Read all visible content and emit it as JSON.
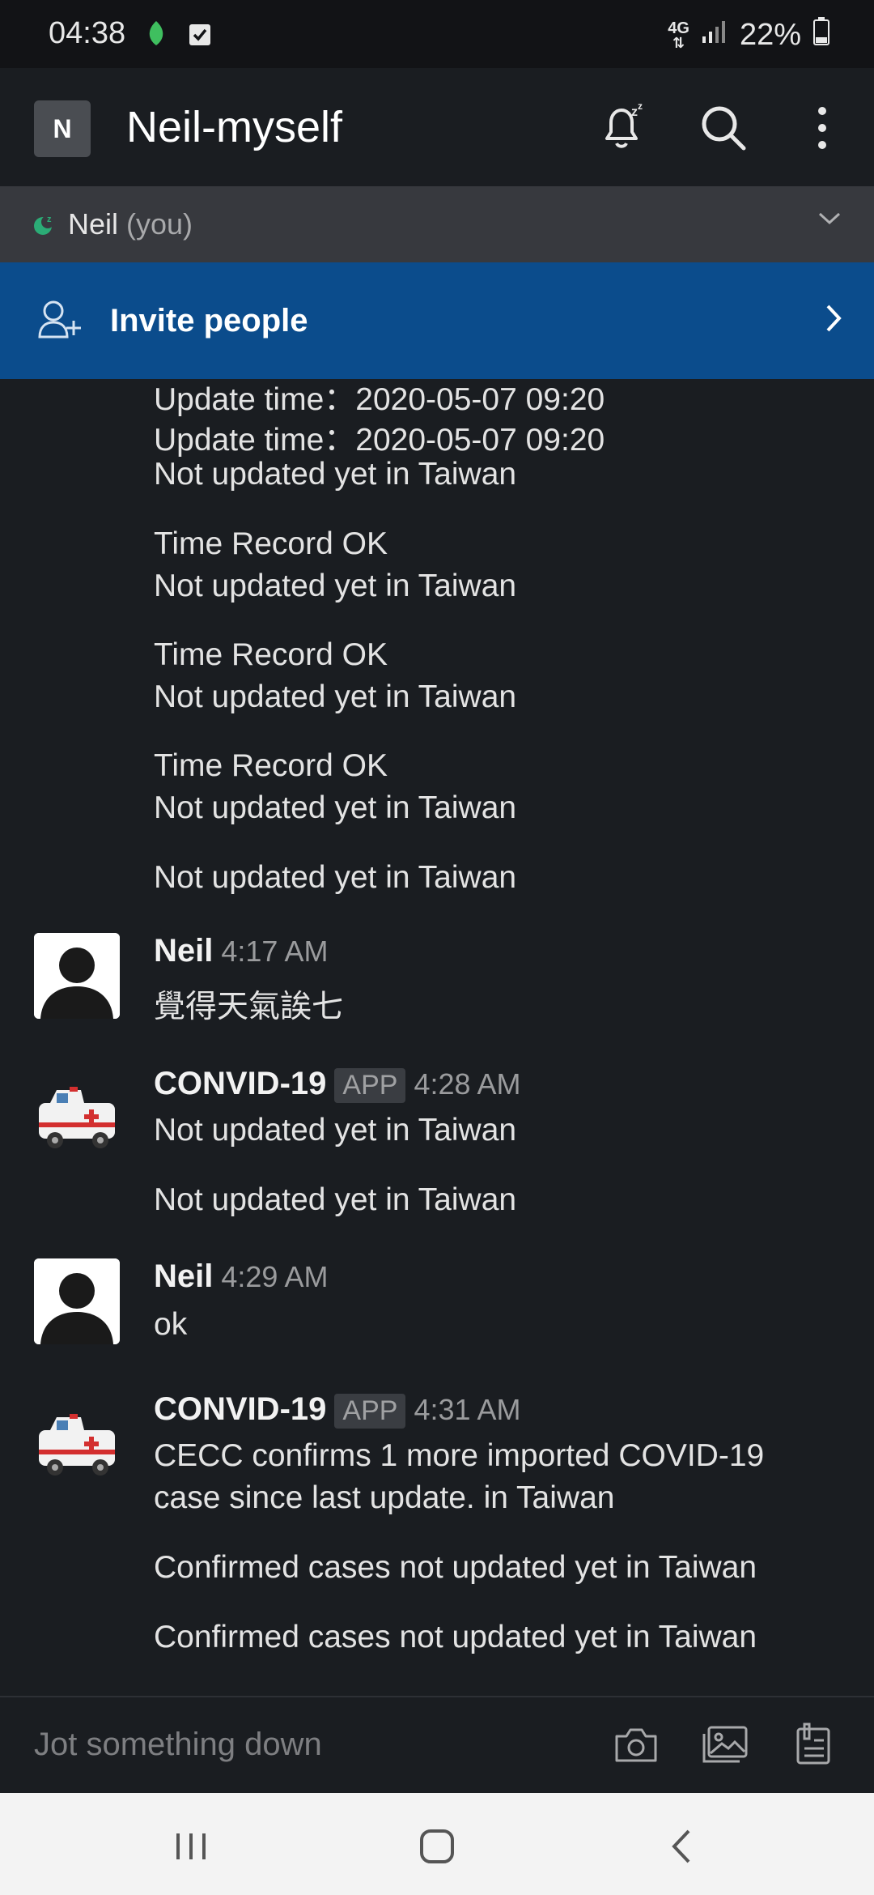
{
  "status_bar": {
    "time": "04:38",
    "network": "4G",
    "battery": "22%"
  },
  "header": {
    "workspace_initial": "N",
    "title": "Neil-myself",
    "icons": [
      "snooze-bell-icon",
      "search-icon",
      "more-vert-icon"
    ]
  },
  "user_strip": {
    "name": "Neil",
    "you_label": "(you)"
  },
  "invite": {
    "label": "Invite people"
  },
  "messages": {
    "lines_top": [
      "Update time：2020-05-07 09:20",
      "Update time：2020-05-07 09:20",
      "Not updated yet in Taiwan",
      "Time Record OK",
      "Not updated yet in Taiwan",
      "Time Record OK",
      "Not updated yet in Taiwan",
      "Time Record OK",
      "Not updated yet in Taiwan",
      "Not updated yet in Taiwan"
    ],
    "m1": {
      "sender": "Neil",
      "time": "4:17 AM",
      "text": "覺得天氣誒七"
    },
    "m2": {
      "sender": "CONVID-19",
      "badge": "APP",
      "time": "4:28 AM",
      "text1": "Not updated yet in Taiwan",
      "text2": "Not updated yet in Taiwan"
    },
    "m3": {
      "sender": "Neil",
      "time": "4:29 AM",
      "text": "ok"
    },
    "m4": {
      "sender": "CONVID-19",
      "badge": "APP",
      "time": "4:31 AM",
      "text1a": "CECC confirms 1 more imported COVID-19",
      "text1b": "case since last update. in Taiwan",
      "text2": "Confirmed cases not updated yet in Taiwan",
      "text3": "Confirmed cases not updated yet in Taiwan"
    }
  },
  "composer": {
    "placeholder": "Jot something down"
  },
  "colors": {
    "background": "#1a1d21",
    "invite_bar": "#0b4c8c",
    "user_strip": "#37393e"
  }
}
